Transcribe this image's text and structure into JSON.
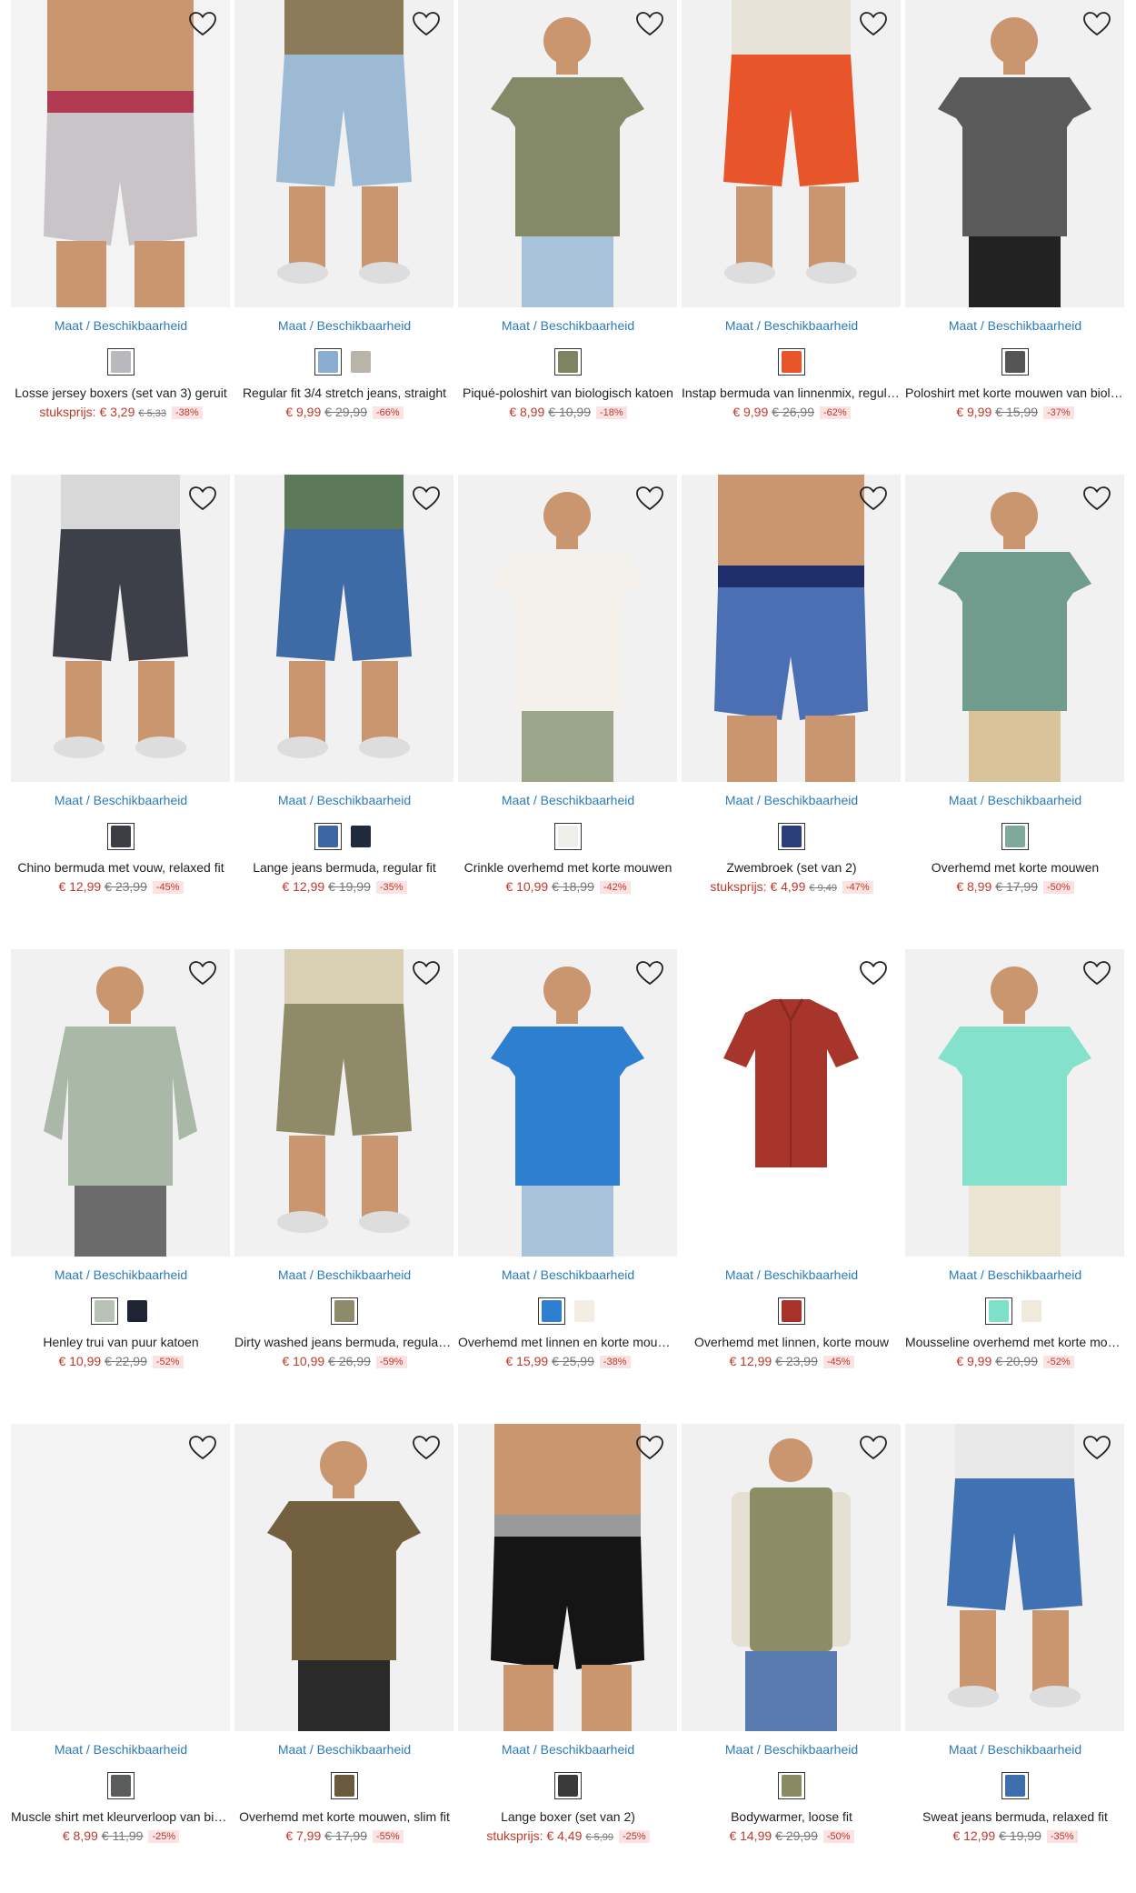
{
  "common": {
    "maat_label": "Maat / Beschikbaarheid"
  },
  "products": [
    {
      "name": "Losse jersey boxers (set van 3) geruit",
      "price": "stuksprijs: € 3,29",
      "old": "€ 5,33",
      "pct": "-38%",
      "swatches": [
        "#b9b9bd"
      ],
      "img": {
        "bg": "#f3f3f3",
        "main": "#c9c4c7",
        "accent": "#b03a52",
        "type": "boxer"
      }
    },
    {
      "name": "Regular fit 3/4 stretch jeans, straight",
      "price": "€ 9,99",
      "old": "€ 29,99",
      "pct": "-66%",
      "swatches": [
        "#8aaed2",
        "#b8b4a8"
      ],
      "img": {
        "bg": "#f1f1f1",
        "main": "#9cbad4",
        "accent": "#8c7b58",
        "type": "shorts"
      }
    },
    {
      "name": "Piqué-poloshirt van biologisch katoen",
      "price": "€ 8,99",
      "old": "€ 10,99",
      "pct": "-18%",
      "swatches": [
        "#7c8462"
      ],
      "img": {
        "bg": "#f1f1f1",
        "main": "#848a68",
        "accent": "#a9c2dc",
        "type": "polo"
      }
    },
    {
      "name": "Instap bermuda van linnenmix, regular fit",
      "price": "€ 9,99",
      "old": "€ 26,99",
      "pct": "-62%",
      "swatches": [
        "#e8552a"
      ],
      "img": {
        "bg": "#f1f1f1",
        "main": "#e8552a",
        "accent": "#e7e3d8",
        "type": "shorts"
      }
    },
    {
      "name": "Poloshirt met korte mouwen van biologisch katoen",
      "price": "€ 9,99",
      "old": "€ 15,99",
      "pct": "-37%",
      "swatches": [
        "#555555"
      ],
      "img": {
        "bg": "#f1f1f1",
        "main": "#5a5a5a",
        "accent": "#222222",
        "type": "polo"
      }
    },
    {
      "name": "Chino bermuda met vouw, relaxed fit",
      "price": "€ 12,99",
      "old": "€ 23,99",
      "pct": "-45%",
      "swatches": [
        "#3b3e45"
      ],
      "img": {
        "bg": "#f1f1f1",
        "main": "#3d4048",
        "accent": "#d8d8d8",
        "type": "shorts"
      }
    },
    {
      "name": "Lange jeans bermuda, regular fit",
      "price": "€ 12,99",
      "old": "€ 19,99",
      "pct": "-35%",
      "swatches": [
        "#3b66a3",
        "#1f2a3c"
      ],
      "img": {
        "bg": "#f1f1f1",
        "main": "#3e6aa6",
        "accent": "#5c7a5a",
        "type": "shorts"
      }
    },
    {
      "name": "Crinkle overhemd met korte mouwen",
      "price": "€ 10,99",
      "old": "€ 18,99",
      "pct": "-42%",
      "swatches": [
        "#f1efe9"
      ],
      "img": {
        "bg": "#f1f1f1",
        "main": "#f3f1ea",
        "accent": "#9aa58a",
        "type": "shirt"
      }
    },
    {
      "name": "Zwembroek (set van 2)",
      "price": "stuksprijs: € 4,99",
      "old": "€ 9,49",
      "pct": "-47%",
      "swatches": [
        "#2a3f7a"
      ],
      "img": {
        "bg": "#f1f1f1",
        "main": "#4b6fb3",
        "accent": "#1f2f6b",
        "type": "boxer"
      }
    },
    {
      "name": "Overhemd met korte mouwen",
      "price": "€ 8,99",
      "old": "€ 17,99",
      "pct": "-50%",
      "swatches": [
        "#7fa99b"
      ],
      "img": {
        "bg": "#f1f1f1",
        "main": "#6f9c8c",
        "accent": "#d8c39b",
        "type": "shirt"
      }
    },
    {
      "name": "Henley trui van puur katoen",
      "price": "€ 10,99",
      "old": "€ 22,99",
      "pct": "-52%",
      "swatches": [
        "#b7c2b5",
        "#1f2435"
      ],
      "img": {
        "bg": "#f1f1f1",
        "main": "#a9b8a7",
        "accent": "#6b6b6b",
        "type": "sweater"
      }
    },
    {
      "name": "Dirty washed jeans bermuda, regular fit",
      "price": "€ 10,99",
      "old": "€ 26,99",
      "pct": "-59%",
      "swatches": [
        "#8e8a6c"
      ],
      "img": {
        "bg": "#f1f1f1",
        "main": "#8f8a68",
        "accent": "#d9cfb3",
        "type": "shorts"
      }
    },
    {
      "name": "Overhemd met linnen en korte mouwen",
      "price": "€ 15,99",
      "old": "€ 25,99",
      "pct": "-38%",
      "swatches": [
        "#2e7fd0",
        "#f3ede2"
      ],
      "img": {
        "bg": "#f1f1f1",
        "main": "#2f7fd1",
        "accent": "#a9c2dc",
        "type": "shirt"
      }
    },
    {
      "name": "Overhemd met linnen, korte mouw",
      "price": "€ 12,99",
      "old": "€ 23,99",
      "pct": "-45%",
      "swatches": [
        "#a8322a"
      ],
      "img": {
        "bg": "#ffffff",
        "main": "#a8352b",
        "accent": "#8a2a22",
        "type": "flatshirt"
      }
    },
    {
      "name": "Mousseline overhemd met korte mouwen",
      "price": "€ 9,99",
      "old": "€ 20,99",
      "pct": "-52%",
      "swatches": [
        "#7fe0c9",
        "#efeadc"
      ],
      "img": {
        "bg": "#f1f1f1",
        "main": "#84e2cc",
        "accent": "#ece4d2",
        "type": "shirt"
      }
    },
    {
      "name": "Muscle shirt met kleurverloop van biologisch katoen",
      "price": "€ 8,99",
      "old": "€ 11,99",
      "pct": "-25%",
      "swatches": [
        "#5b5d5d"
      ],
      "img": {
        "bg": "#f3f3f3",
        "main": "#f3f3f3",
        "accent": "#f3f3f3",
        "type": "blank"
      }
    },
    {
      "name": "Overhemd met korte mouwen, slim fit",
      "price": "€ 7,99",
      "old": "€ 17,99",
      "pct": "-55%",
      "swatches": [
        "#6b5b3e"
      ],
      "img": {
        "bg": "#f1f1f1",
        "main": "#73603f",
        "accent": "#2a2a2a",
        "type": "shirt"
      }
    },
    {
      "name": "Lange boxer (set van 2)",
      "price": "stuksprijs: € 4,49",
      "old": "€ 5,99",
      "pct": "-25%",
      "swatches": [
        "#3a3a3a"
      ],
      "img": {
        "bg": "#f1f1f1",
        "main": "#151515",
        "accent": "#9a9a9a",
        "type": "boxer"
      }
    },
    {
      "name": "Bodywarmer, loose fit",
      "price": "€ 14,99",
      "old": "€ 29,99",
      "pct": "-50%",
      "swatches": [
        "#8a8a62"
      ],
      "img": {
        "bg": "#f1f1f1",
        "main": "#8c8c66",
        "accent": "#e6e0d3",
        "type": "vest"
      }
    },
    {
      "name": "Sweat jeans bermuda, relaxed fit",
      "price": "€ 12,99",
      "old": "€ 19,99",
      "pct": "-35%",
      "swatches": [
        "#3d6eae"
      ],
      "img": {
        "bg": "#f1f1f1",
        "main": "#3f71b3",
        "accent": "#e9e9e9",
        "type": "shorts"
      }
    }
  ]
}
